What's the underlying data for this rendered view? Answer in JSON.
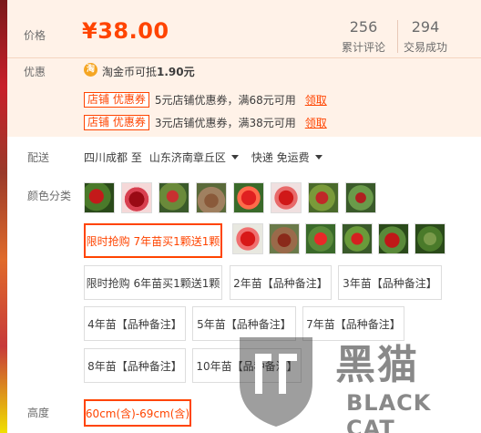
{
  "price": {
    "label": "价格",
    "value": "¥38.00",
    "stats": [
      {
        "num": "256",
        "label": "累计评论"
      },
      {
        "num": "294",
        "label": "交易成功"
      }
    ]
  },
  "promo": {
    "label": "优惠",
    "coin_icon": "淘",
    "coin_text_prefix": "淘金币可抵",
    "coin_amount": "1.90元",
    "coupons": [
      {
        "tag": "店铺 优惠券",
        "desc": "5元店铺优惠券，满68元可用",
        "link": "领取"
      },
      {
        "tag": "店铺 优惠券",
        "desc": "3元店铺优惠券，满38元可用",
        "link": "领取"
      }
    ]
  },
  "shipping": {
    "label": "配送",
    "from": "四川成都 至",
    "to": "山东济南章丘区",
    "method": "快递 免运费"
  },
  "colors": {
    "label": "颜色分类",
    "options": [
      "限时抢购 7年苗买1颗送1颗",
      "限时抢购 6年苗买1颗送1颗",
      "2年苗【品种备注】",
      "3年苗【品种备注】",
      "4年苗【品种备注】",
      "5年苗【品种备注】",
      "7年苗【品种备注】",
      "8年苗【品种备注】",
      "10年苗【品种备注】"
    ],
    "selected": "限时抢购 7年苗买1颗送1颗"
  },
  "height": {
    "label": "高度",
    "selected": "60cm(含)-69cm(含)"
  },
  "watermark": {
    "cn": "黑猫",
    "en": "BLACK CAT"
  }
}
